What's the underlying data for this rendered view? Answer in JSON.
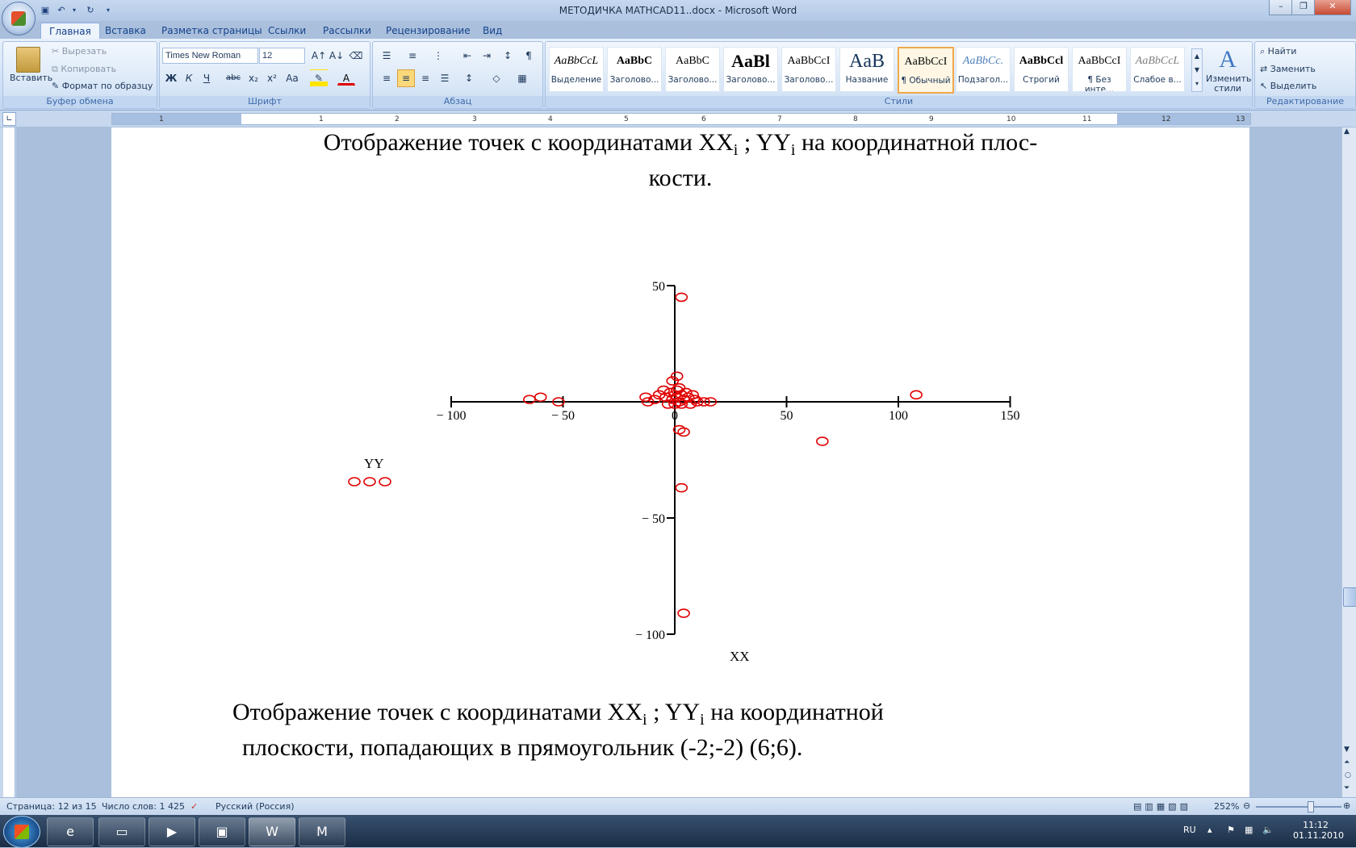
{
  "window": {
    "title": "МЕТОДИЧКА MATHCAD11..docx - Microsoft Word",
    "controls": {
      "minimize": "–",
      "restore": "❐",
      "close": "✕"
    }
  },
  "tabs": [
    "Главная",
    "Вставка",
    "Разметка страницы",
    "Ссылки",
    "Рассылки",
    "Рецензирование",
    "Вид"
  ],
  "ribbon": {
    "clipboard": {
      "label": "Буфер обмена",
      "paste": "Вставить",
      "cut": "Вырезать",
      "copy": "Копировать",
      "format_painter": "Формат по образцу"
    },
    "font": {
      "label": "Шрифт",
      "family": "Times New Roman",
      "size": "12",
      "bold": "Ж",
      "italic": "К",
      "underline": "Ч",
      "strike": "abc",
      "subscript": "x₂",
      "superscript": "x²",
      "change_case": "Aa"
    },
    "paragraph": {
      "label": "Абзац"
    },
    "styles": {
      "label": "Стили",
      "items": [
        {
          "sample": "AaBbCcL",
          "name": "Выделение"
        },
        {
          "sample": "AaBbC",
          "name": "Заголово..."
        },
        {
          "sample": "AaBbC",
          "name": "Заголово..."
        },
        {
          "sample": "AaBl",
          "name": "Заголово..."
        },
        {
          "sample": "AaBbCcI",
          "name": "Заголово..."
        },
        {
          "sample": "AaB",
          "name": "Название"
        },
        {
          "sample": "AaBbCcI",
          "name": "¶ Обычный"
        },
        {
          "sample": "AaBbCc.",
          "name": "Подзагол..."
        },
        {
          "sample": "AaBbCcl",
          "name": "Строгий"
        },
        {
          "sample": "AaBbCcI",
          "name": "¶ Без инте..."
        },
        {
          "sample": "AaBbCcL",
          "name": "Слабое в..."
        }
      ],
      "change_styles": "Изменить стили"
    },
    "editing": {
      "label": "Редактирование",
      "find": "Найти",
      "replace": "Заменить",
      "select": "Выделить"
    }
  },
  "ruler": {
    "ticks": [
      "1",
      "1",
      "2",
      "3",
      "4",
      "5",
      "6",
      "7",
      "8",
      "9",
      "10",
      "11",
      "12",
      "13"
    ]
  },
  "document": {
    "heading1_a": "Отображение точек с координатами XX",
    "heading1_sub_i": "i",
    "heading1_b": " ; YY",
    "heading1_c": " на координатной плос-",
    "heading1_line2": "кости.",
    "plot_ylabel": "YY",
    "plot_xlabel": "XX",
    "para2_a": "Отображение точек с координатами XX",
    "para2_b": " ; YY",
    "para2_c": " на координатной",
    "para2_line2": "плоскости, попадающих в прямоугольник (-2;-2) (6;6)."
  },
  "chart_data": {
    "type": "scatter",
    "xlabel": "XX",
    "ylabel": "YY",
    "xlim": [
      -100,
      150
    ],
    "ylim": [
      -100,
      50
    ],
    "x_ticks": [
      "− 100",
      "− 50",
      "0",
      "50",
      "100",
      "150"
    ],
    "y_ticks": [
      "50",
      "− 50",
      "− 100"
    ],
    "marker": "circle",
    "marker_color": "#e00000",
    "points": [
      [
        3,
        45
      ],
      [
        -65,
        1
      ],
      [
        -60,
        2
      ],
      [
        -52,
        0
      ],
      [
        -13,
        2
      ],
      [
        -12,
        0
      ],
      [
        -9,
        1
      ],
      [
        -7,
        3
      ],
      [
        -5,
        5
      ],
      [
        -4,
        2
      ],
      [
        -3,
        -1
      ],
      [
        -2,
        4
      ],
      [
        -1,
        9
      ],
      [
        -1,
        1
      ],
      [
        0,
        3
      ],
      [
        0,
        -1
      ],
      [
        1,
        11
      ],
      [
        1,
        5
      ],
      [
        1,
        2
      ],
      [
        2,
        0
      ],
      [
        2,
        6
      ],
      [
        3,
        3
      ],
      [
        3,
        -1
      ],
      [
        4,
        1
      ],
      [
        5,
        4
      ],
      [
        6,
        2
      ],
      [
        7,
        -1
      ],
      [
        8,
        3
      ],
      [
        9,
        1
      ],
      [
        10,
        0
      ],
      [
        13,
        0
      ],
      [
        16,
        0
      ],
      [
        2,
        -12
      ],
      [
        4,
        -13
      ],
      [
        66,
        -17
      ],
      [
        108,
        3
      ],
      [
        3,
        -37
      ],
      [
        4,
        -91
      ]
    ],
    "legend_markers": 3
  },
  "statusbar": {
    "page": "Страница: 12 из 15",
    "words": "Число слов: 1 425",
    "language": "Русский (Россия)",
    "zoom": "252%"
  },
  "taskbar": {
    "lang": "RU",
    "time": "11:12",
    "date": "01.11.2010"
  }
}
